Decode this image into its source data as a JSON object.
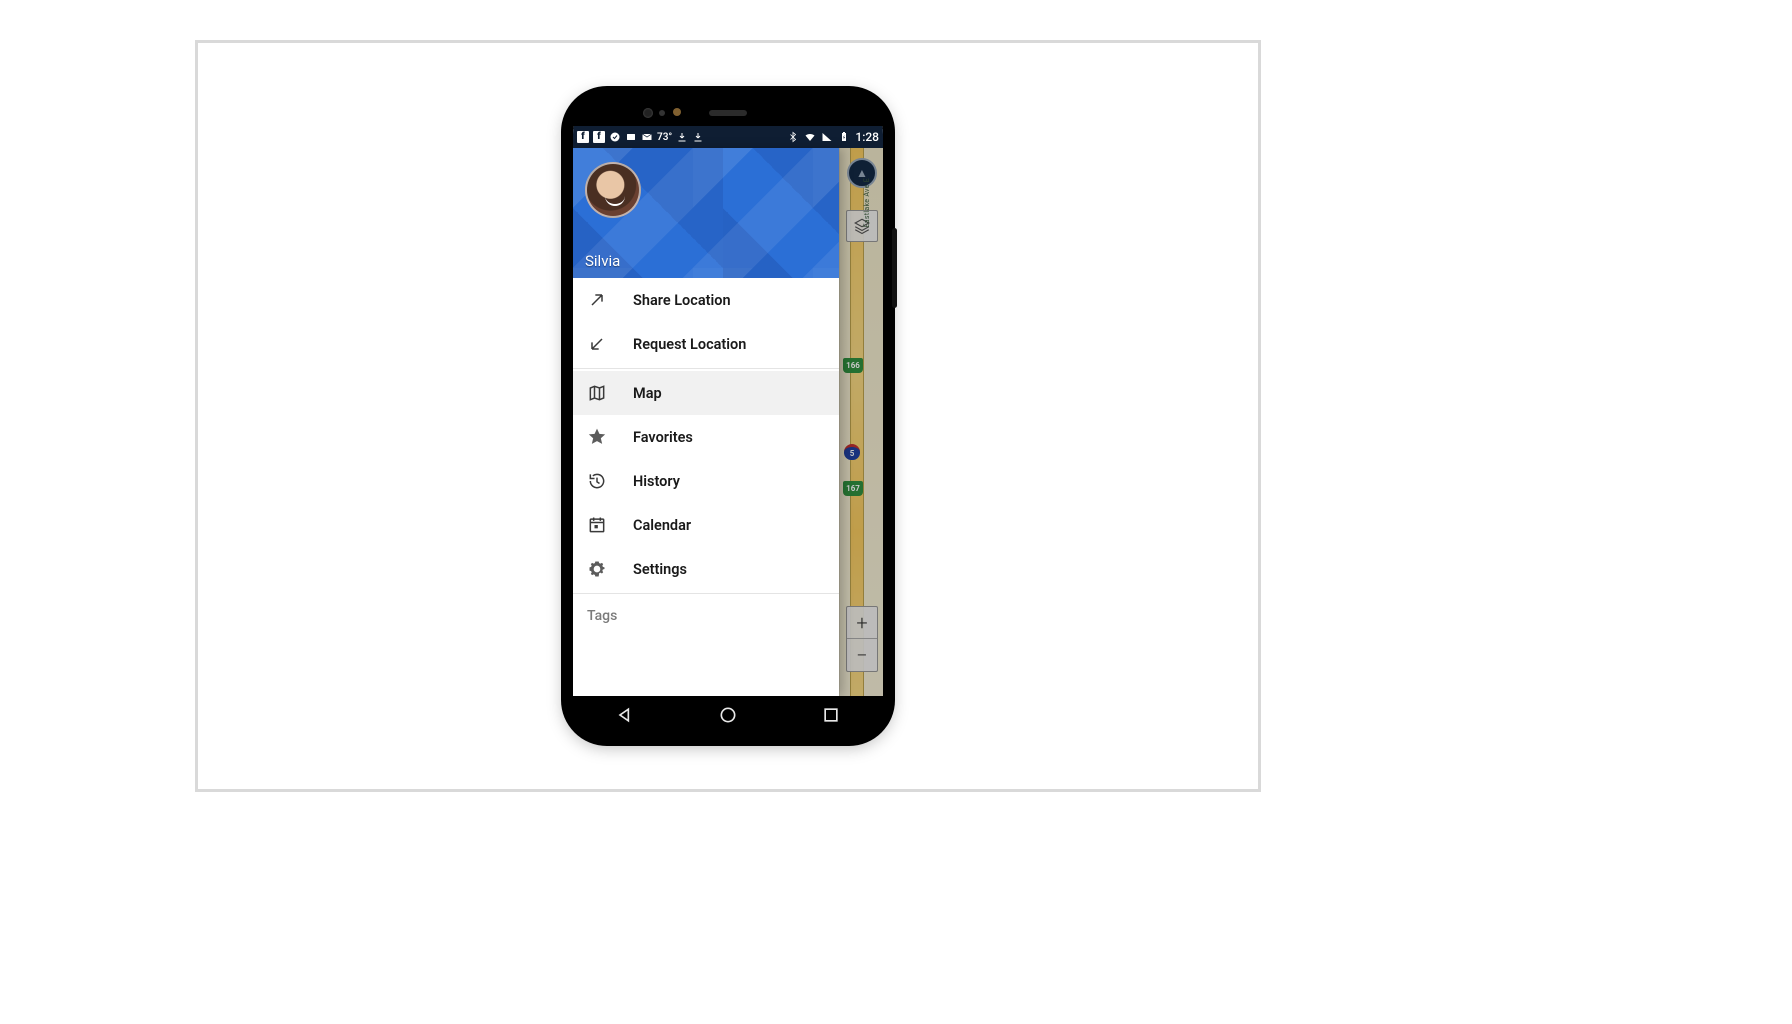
{
  "statusbar": {
    "temperature": "73°",
    "time": "1:28"
  },
  "drawer": {
    "user_name": "Silvia",
    "items": {
      "share_location": "Share Location",
      "request_location": "Request Location",
      "map": "Map",
      "favorites": "Favorites",
      "history": "History",
      "calendar": "Calendar",
      "settings": "Settings"
    },
    "section_tags": "Tags"
  },
  "map": {
    "road_label": "Eastlake Ave E",
    "shield_a": "166",
    "shield_b": "167",
    "interstate": "5",
    "compass_glyph": "▲",
    "zoom_in": "+",
    "zoom_out": "−"
  },
  "nav": {
    "back": "back",
    "home": "home",
    "recents": "recents"
  }
}
